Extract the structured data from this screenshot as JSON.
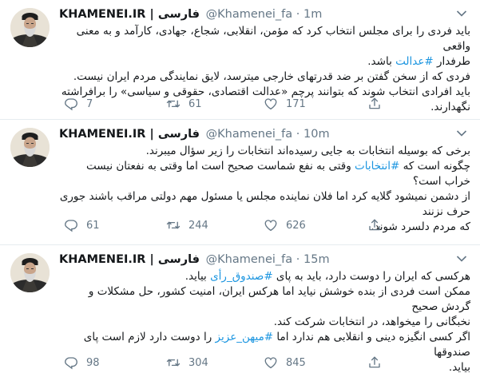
{
  "tweets": [
    {
      "name": "KHAMENEI.IR | فارسی",
      "handle": "@Khamenei_fa",
      "sep": "·",
      "time": "1m",
      "line1_a": "باید فردی را برای مجلس انتخاب کرد که مؤمن، انقلابی، شجاع، جهادی، کارآمد و به معنی واقعی",
      "line1_b_pre": "طرفدار ",
      "line1_b_tag": "#عدالت",
      "line1_b_post": " باشد.",
      "line2": "فردی که از سخن گفتن بر ضد قدرتهای خارجی میترسد، لایق نمایندگی مردم ایران نیست.",
      "line3": "باید افرادی انتخاب شوند که بتوانند پرچم «عدالت اقتصادی، حقوقی و سیاسی» را برافراشته نگهدارند.",
      "replies": "7",
      "retweets": "61",
      "likes": "171"
    },
    {
      "name": "KHAMENEI.IR | فارسی",
      "handle": "@Khamenei_fa",
      "sep": "·",
      "time": "10m",
      "line1": "برخی که بوسیله انتخابات به جایی رسیده‌اند انتخابات را زیر سؤال میبرند.",
      "line2_pre": "چگونه است که ",
      "line2_tag": "#انتخابات",
      "line2_post": " وقتی به نفع شماست صحیح است اما وقتی به نفعتان نیست خراب است؟",
      "line3": "از دشمن نمیشود گلایه کرد اما فلان نماینده مجلس یا مسئول مهم دولتی مراقب باشند جوری حرف نزنند",
      "line4": "که مردم دلسرد شوند.",
      "replies": "61",
      "retweets": "244",
      "likes": "626"
    },
    {
      "name": "KHAMENEI.IR | فارسی",
      "handle": "@Khamenei_fa",
      "sep": "·",
      "time": "15m",
      "line1_pre": "هرکسی که ایران را دوست دارد، باید به پای ",
      "line1_tag": "#صندوق_رأی",
      "line1_post": " بیاید.",
      "line2": "ممکن است فردی از بنده خوشش نیاید اما هرکس ایران، امنیت کشور، حل مشکلات و گردش صحیح",
      "line3": "نخبگانی را میخواهد، در انتخابات شرکت کند.",
      "line4_pre": "اگر کسی انگیزه دینی و انقلابی هم ندارد اما ",
      "line4_tag": "#میهن_عزیز",
      "line4_post": " را دوست دارد لازم است پای صندوقها",
      "line5": "بیاید.",
      "replies": "98",
      "retweets": "304",
      "likes": "845"
    }
  ],
  "colors": {
    "hashtag": "#1b95e0",
    "muted": "#657786",
    "divider": "#e6ecf0"
  },
  "icons": [
    "avatar",
    "chevron-down-icon",
    "reply-icon",
    "retweet-icon",
    "like-icon",
    "share-icon"
  ]
}
